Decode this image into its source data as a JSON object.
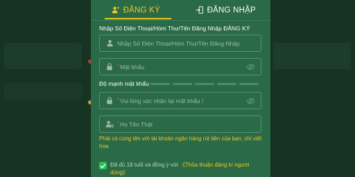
{
  "tabs": {
    "register_label": "ĐĂNG KÝ",
    "login_label": "ĐĂNG NHẬP"
  },
  "form": {
    "account_label": "Nhập Số Điện Thoại/Hòm Thư/Tên Đăng Nhập ĐĂNG KÝ",
    "account_placeholder": "Nhập Số Điện Thoại/Hòm Thư/Tên Đăng Nhập",
    "password_placeholder": "Mật khẩu",
    "strength_label": "Độ mạnh mật khẩu",
    "confirm_placeholder": "Vui lòng xác nhận lại mật khẩu !",
    "realname_placeholder": "Họ Tên Thật",
    "realname_hint": "Phải có cùng tên với tài khoản ngân hàng rút tiền của bạn, chỉ viết hoa",
    "required_mark": "*",
    "agree_text": "Đã đủ 18 tuổi và đồng ý với",
    "agree_link": "《Thỏa thuận đăng kí người dùng》",
    "agree_checked": true
  },
  "icons": {
    "register_tab": "user-plus-icon",
    "login_tab": "login-door-icon",
    "account": "user-icon",
    "password": "lock-icon",
    "password_toggle": "eye-off-icon",
    "confirm": "lock-icon",
    "confirm_toggle": "eye-off-icon",
    "realname": "id-user-icon",
    "checkbox": "check-icon"
  },
  "colors": {
    "modal_bg": "#2a6a47",
    "accent": "#f3c623",
    "required": "#e0534a",
    "checkbox": "#27c15c",
    "background": "#13291d"
  }
}
